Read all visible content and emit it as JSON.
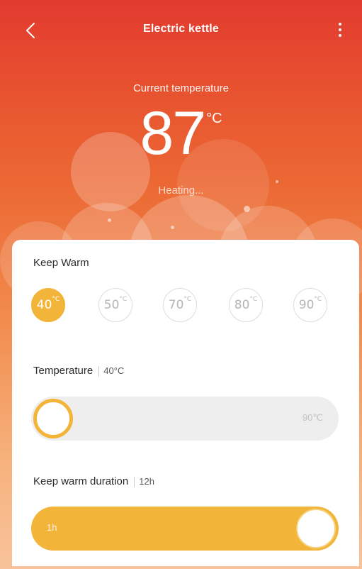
{
  "header": {
    "back_icon": "chevron-left-icon",
    "title": "Electric kettle",
    "more_icon": "more-vertical-icon"
  },
  "hero": {
    "label": "Current temperature",
    "temperature": "87",
    "unit": "°C",
    "status": "Heating..."
  },
  "keep_warm": {
    "label": "Keep Warm",
    "presets": [
      {
        "value": "40",
        "unit": "°C",
        "selected": true
      },
      {
        "value": "50",
        "unit": "°C",
        "selected": false
      },
      {
        "value": "70",
        "unit": "°C",
        "selected": false
      },
      {
        "value": "80",
        "unit": "°C",
        "selected": false
      },
      {
        "value": "90",
        "unit": "°C",
        "selected": false
      }
    ]
  },
  "temperature_setting": {
    "label": "Temperature",
    "value": "40°C",
    "max_label": "90℃",
    "level": 0
  },
  "duration_setting": {
    "label": "Keep warm duration",
    "value": "12h",
    "min_label": "1h",
    "level": 1
  },
  "colors": {
    "accent": "#f2b53a",
    "header_red": "#e23a2f",
    "text_dark": "#2b2b2b",
    "inactive": "#b5b5b5"
  }
}
